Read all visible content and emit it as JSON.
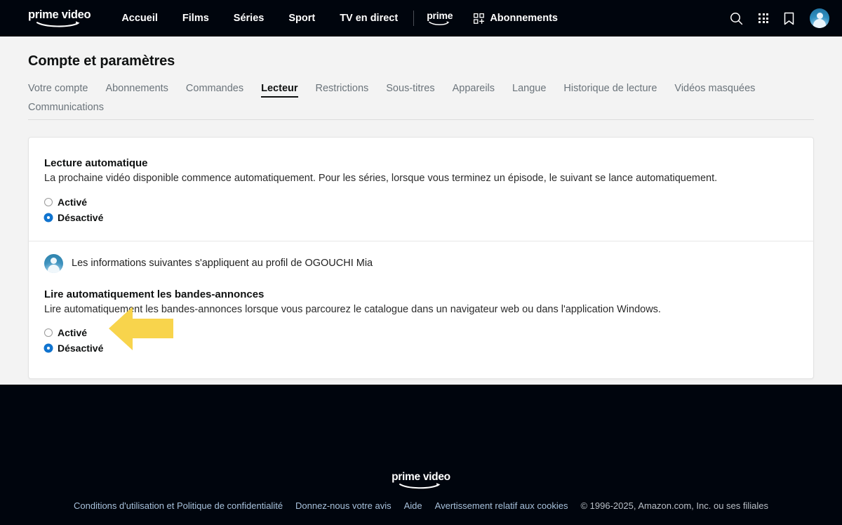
{
  "header": {
    "logo": "prime video",
    "nav": [
      {
        "label": "Accueil",
        "name": "nav-accueil"
      },
      {
        "label": "Films",
        "name": "nav-films"
      },
      {
        "label": "Séries",
        "name": "nav-series"
      },
      {
        "label": "Sport",
        "name": "nav-sport"
      },
      {
        "label": "TV en direct",
        "name": "nav-tv-en-direct"
      }
    ],
    "prime_badge": "prime",
    "subscriptions": "Abonnements",
    "icons": {
      "search": "search-icon",
      "apps": "apps-grid-icon",
      "bookmark": "bookmark-icon",
      "avatar": "user-avatar"
    }
  },
  "page": {
    "title": "Compte et paramètres",
    "tabs": [
      {
        "label": "Votre compte",
        "active": false
      },
      {
        "label": "Abonnements",
        "active": false
      },
      {
        "label": "Commandes",
        "active": false
      },
      {
        "label": "Lecteur",
        "active": true
      },
      {
        "label": "Restrictions",
        "active": false
      },
      {
        "label": "Sous-titres",
        "active": false
      },
      {
        "label": "Appareils",
        "active": false
      },
      {
        "label": "Langue",
        "active": false
      },
      {
        "label": "Historique de lecture",
        "active": false
      },
      {
        "label": "Vidéos masquées",
        "active": false
      },
      {
        "label": "Communications",
        "active": false
      }
    ]
  },
  "autoplay": {
    "title": "Lecture automatique",
    "description": "La prochaine vidéo disponible commence automatiquement. Pour les séries, lorsque vous terminez un épisode, le suivant se lance automatiquement.",
    "options": [
      {
        "label": "Activé",
        "selected": false
      },
      {
        "label": "Désactivé",
        "selected": true
      }
    ]
  },
  "profile_notice": {
    "text": "Les informations suivantes s'appliquent au profil de OGOUCHI Mia",
    "profile_name": "OGOUCHI Mia"
  },
  "trailers": {
    "title": "Lire automatiquement les bandes-annonces",
    "description": "Lire automatiquement les bandes-annonces lorsque vous parcourez le catalogue dans un navigateur web ou dans l'application Windows.",
    "options": [
      {
        "label": "Activé",
        "selected": false
      },
      {
        "label": "Désactivé",
        "selected": true
      }
    ]
  },
  "annotation": {
    "type": "arrow-left",
    "color": "#f8d44c",
    "points_at": "Désactivé"
  },
  "footer": {
    "logo": "prime video",
    "links": [
      {
        "label": "Conditions d'utilisation et Politique de confidentialité"
      },
      {
        "label": "Donnez-nous votre avis"
      },
      {
        "label": "Aide"
      },
      {
        "label": "Avertissement relatif aux cookies"
      }
    ],
    "copyright": "© 1996-2025, Amazon.com, Inc. ou ses filiales"
  },
  "colors": {
    "header_bg": "#00050d",
    "page_bg": "#f3f3f3",
    "card_bg": "#ffffff",
    "radio_selected": "#1176d1",
    "annotation_yellow": "#f8d44c",
    "footer_link": "#a7c1db"
  }
}
